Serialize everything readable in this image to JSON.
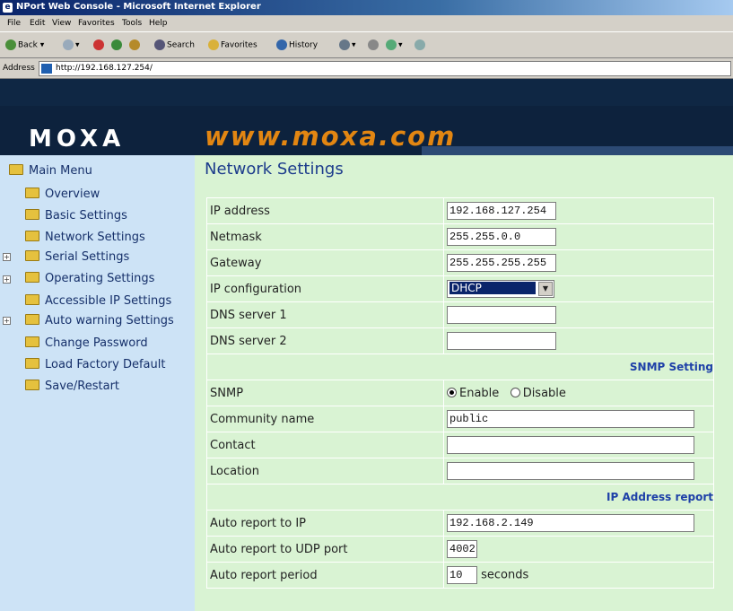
{
  "window": {
    "title": "NPort Web Console - Microsoft Internet Explorer"
  },
  "menubar": {
    "items": [
      "File",
      "Edit",
      "View",
      "Favorites",
      "Tools",
      "Help"
    ]
  },
  "toolbar": {
    "back": "Back",
    "search": "Search",
    "favorites": "Favorites",
    "history": "History"
  },
  "address": {
    "label": "Address",
    "url": "http://192.168.127.254/"
  },
  "header": {
    "logo": "MOXA",
    "site": "www.moxa.com"
  },
  "sidebar": {
    "root": "Main Menu",
    "items": [
      {
        "label": "Overview"
      },
      {
        "label": "Basic Settings"
      },
      {
        "label": "Network Settings"
      },
      {
        "label": "Serial Settings"
      },
      {
        "label": "Operating Settings"
      },
      {
        "label": "Accessible IP Settings"
      },
      {
        "label": "Auto warning Settings"
      },
      {
        "label": "Change Password"
      },
      {
        "label": "Load Factory Default"
      },
      {
        "label": "Save/Restart"
      }
    ]
  },
  "page": {
    "title": "Network Settings"
  },
  "form": {
    "ip_label": "IP address",
    "ip_value": "192.168.127.254",
    "netmask_label": "Netmask",
    "netmask_value": "255.255.0.0",
    "gateway_label": "Gateway",
    "gateway_value": "255.255.255.255",
    "ipconf_label": "IP configuration",
    "ipconf_value": "DHCP",
    "dns1_label": "DNS server 1",
    "dns1_value": "",
    "dns2_label": "DNS server 2",
    "dns2_value": "",
    "snmp_section": "SNMP Setting",
    "snmp_label": "SNMP",
    "snmp_enable": "Enable",
    "snmp_disable": "Disable",
    "community_label": "Community name",
    "community_value": "public",
    "contact_label": "Contact",
    "contact_value": "",
    "location_label": "Location",
    "location_value": "",
    "ipreport_section": "IP Address report",
    "autoip_label": "Auto report to IP",
    "autoip_value": "192.168.2.149",
    "autoport_label": "Auto report to UDP port",
    "autoport_value": "4002",
    "period_label": "Auto report period",
    "period_value": "10",
    "period_unit": "seconds"
  },
  "colors": {
    "header_bg": "#0d223d",
    "site_text": "#e28612",
    "sidebar_bg": "#cde3f6",
    "content_bg": "#d9f3d3",
    "title_text": "#1d3c8c"
  }
}
